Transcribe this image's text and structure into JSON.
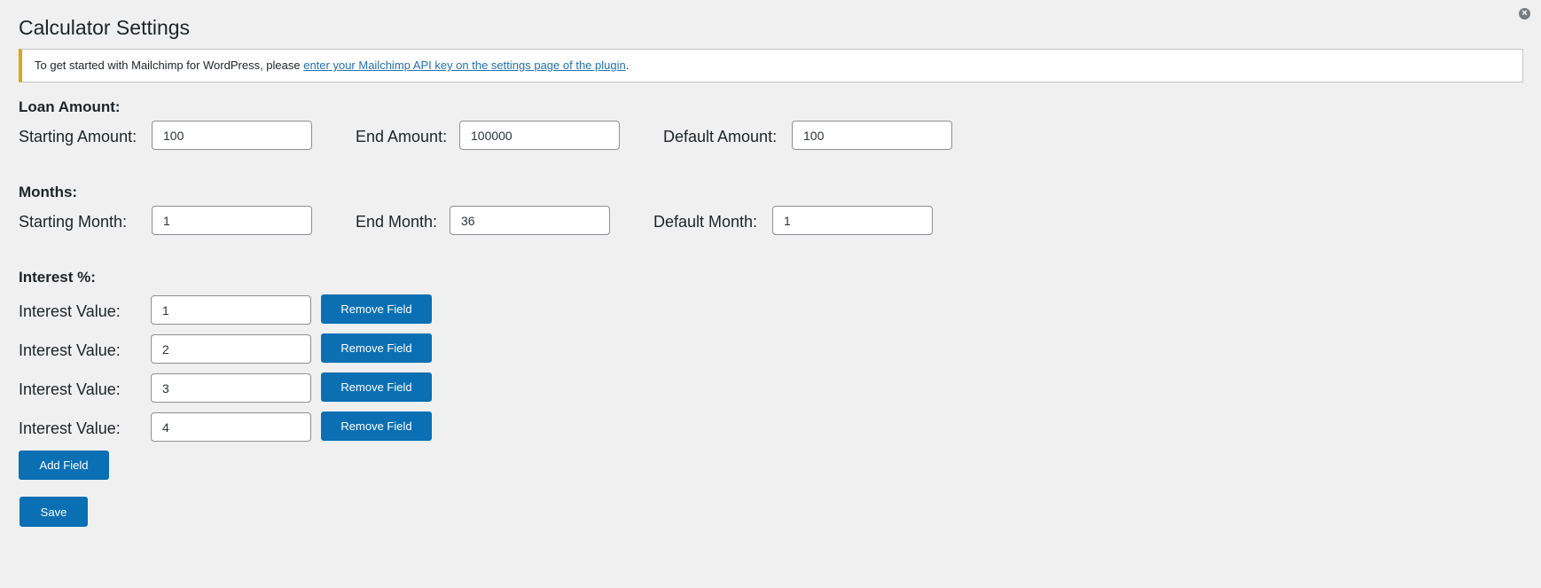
{
  "page": {
    "title": "Calculator Settings",
    "close_icon": "close-icon"
  },
  "notice": {
    "text_before": "To get started with Mailchimp for WordPress, please ",
    "link_text": "enter your Mailchimp API key on the settings page of the plugin",
    "text_after": ".",
    "accent_color": "#dba617"
  },
  "loan": {
    "heading": "Loan Amount:",
    "starting_label": "Starting Amount:",
    "starting_value": "100",
    "end_label": "End Amount:",
    "end_value": "100000",
    "default_label": "Default Amount:",
    "default_value": "100"
  },
  "months": {
    "heading": "Months:",
    "starting_label": "Starting Month:",
    "starting_value": "1",
    "end_label": "End Month:",
    "end_value": "36",
    "default_label": "Default Month:",
    "default_value": "1"
  },
  "interest": {
    "heading": "Interest %:",
    "rows": [
      {
        "label": "Interest Value:",
        "value": "1",
        "remove_label": "Remove Field"
      },
      {
        "label": "Interest Value:",
        "value": "2",
        "remove_label": "Remove Field"
      },
      {
        "label": "Interest Value:",
        "value": "3",
        "remove_label": "Remove Field"
      },
      {
        "label": "Interest Value:",
        "value": "4",
        "remove_label": "Remove Field"
      }
    ],
    "add_label": "Add Field"
  },
  "actions": {
    "save_label": "Save"
  },
  "colors": {
    "primary_button": "#0a6fb3",
    "background": "#f0f0f1",
    "link": "#2271b1"
  }
}
